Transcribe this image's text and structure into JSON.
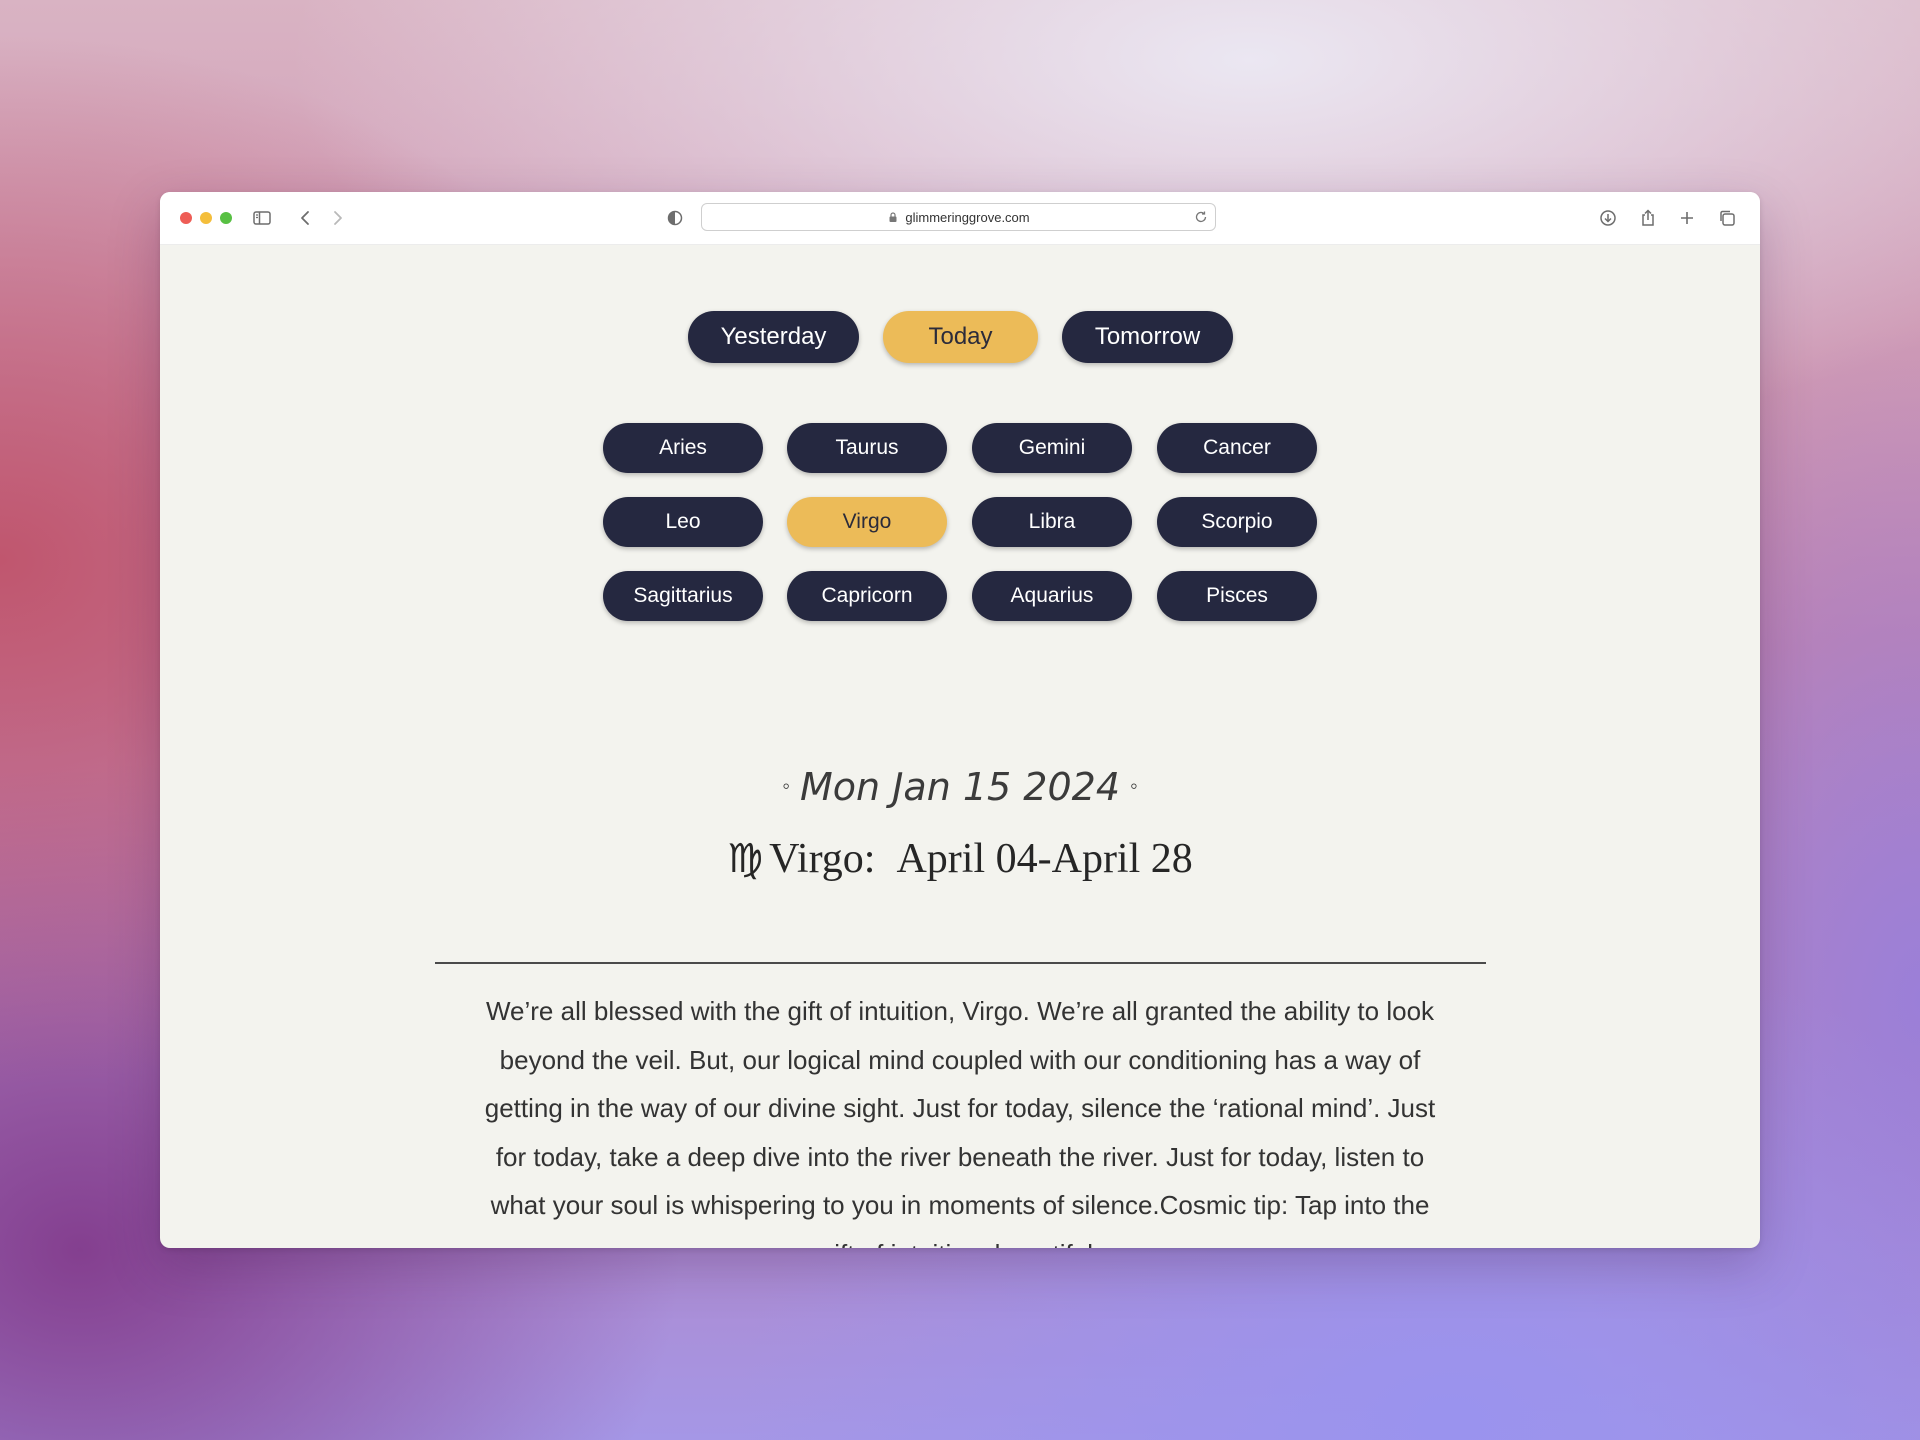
{
  "browser": {
    "url": "glimmeringgrove.com",
    "traffic_lights": {
      "close": "#ee5d56",
      "minimize": "#f4be3b",
      "maximize": "#58c043"
    }
  },
  "colors": {
    "accent": "#ecbb58",
    "pill_dark": "#252840",
    "page_bg": "#f3f3ee"
  },
  "day_tabs": [
    {
      "label": "Yesterday",
      "active": false
    },
    {
      "label": "Today",
      "active": true
    },
    {
      "label": "Tomorrow",
      "active": false
    }
  ],
  "signs": [
    {
      "label": "Aries",
      "active": false
    },
    {
      "label": "Taurus",
      "active": false
    },
    {
      "label": "Gemini",
      "active": false
    },
    {
      "label": "Cancer",
      "active": false
    },
    {
      "label": "Leo",
      "active": false
    },
    {
      "label": "Virgo",
      "active": true
    },
    {
      "label": "Libra",
      "active": false
    },
    {
      "label": "Scorpio",
      "active": false
    },
    {
      "label": "Sagittarius",
      "active": false
    },
    {
      "label": "Capricorn",
      "active": false
    },
    {
      "label": "Aquarius",
      "active": false
    },
    {
      "label": "Pisces",
      "active": false
    }
  ],
  "horoscope": {
    "date": "Mon Jan 15 2024",
    "date_ornament": "◦",
    "sign_symbol": "♍",
    "sign_name": "Virgo:",
    "date_range": "April 04-April 28",
    "text": "We’re all blessed with the gift of intuition, Virgo. We’re all granted the ability to look beyond the veil. But, our logical mind coupled with our conditioning has a way of getting in the way of our divine sight. Just for today, silence the ‘rational mind’. Just for today, take a deep dive into the river beneath the river. Just for today, listen to what your soul is whispering to you in moments of silence.Cosmic tip: Tap into the gift of intuition, beautiful."
  }
}
